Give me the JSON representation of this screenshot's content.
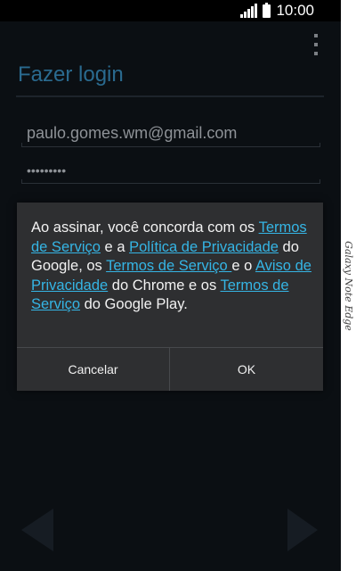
{
  "status_bar": {
    "time": "10:00"
  },
  "header": {
    "title": "Fazer login"
  },
  "form": {
    "email": "paulo.gomes.wm@gmail.com",
    "password": "•••••••••"
  },
  "dialog": {
    "text": {
      "part1": "Ao assinar, você concorda com os ",
      "link_terms_1": "Termos de Serviço",
      "part2": " e a ",
      "link_privacy": "Política de Privacidade",
      "part3": " do Google, os ",
      "link_terms_chrome": " Termos de Serviço ",
      "part4": " e o ",
      "link_chrome_notice": " Aviso de Privacidade",
      "part5": " do Chrome e os ",
      "link_terms_play": "Termos de Serviço",
      "part6": " do Google Play."
    },
    "cancel_label": "Cancelar",
    "ok_label": "OK"
  },
  "device_edge": {
    "label": "Galaxy Note Edge"
  },
  "icons": {
    "menu": "overflow-menu-icon",
    "prev": "previous-arrow-icon",
    "next": "next-arrow-icon",
    "signal": "signal-icon",
    "battery": "battery-icon"
  },
  "colors": {
    "accent": "#35b5e5",
    "title": "#2a6a8f",
    "background": "#0b0f13",
    "dialog": "#2e2f31"
  }
}
